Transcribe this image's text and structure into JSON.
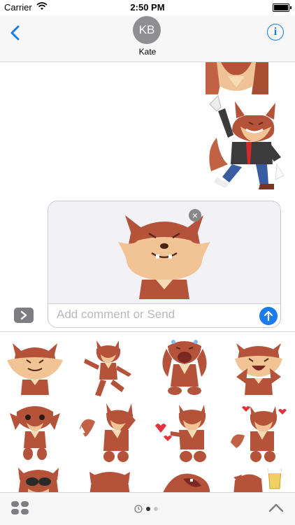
{
  "status_bar": {
    "carrier": "Carrier",
    "time": "2:50 PM"
  },
  "nav": {
    "avatar_initials": "KB",
    "contact_name": "Kate",
    "info_icon": "info-icon",
    "back_icon": "chevron-left-icon"
  },
  "compose": {
    "placeholder": "Add comment or Send",
    "remove_icon": "close-icon",
    "send_icon": "arrow-up-icon",
    "expand_icon": "chevron-right-icon"
  },
  "tray": {
    "apps_icon": "app-grid-icon",
    "recents_icon": "clock-icon",
    "collapse_icon": "chevron-up-icon",
    "page_count": 2,
    "active_page": 1
  },
  "colors": {
    "accent": "#1a7cf0",
    "fox_fur": "#b5533a",
    "fox_light": "#f2c495",
    "fox_dark": "#7a3324"
  }
}
